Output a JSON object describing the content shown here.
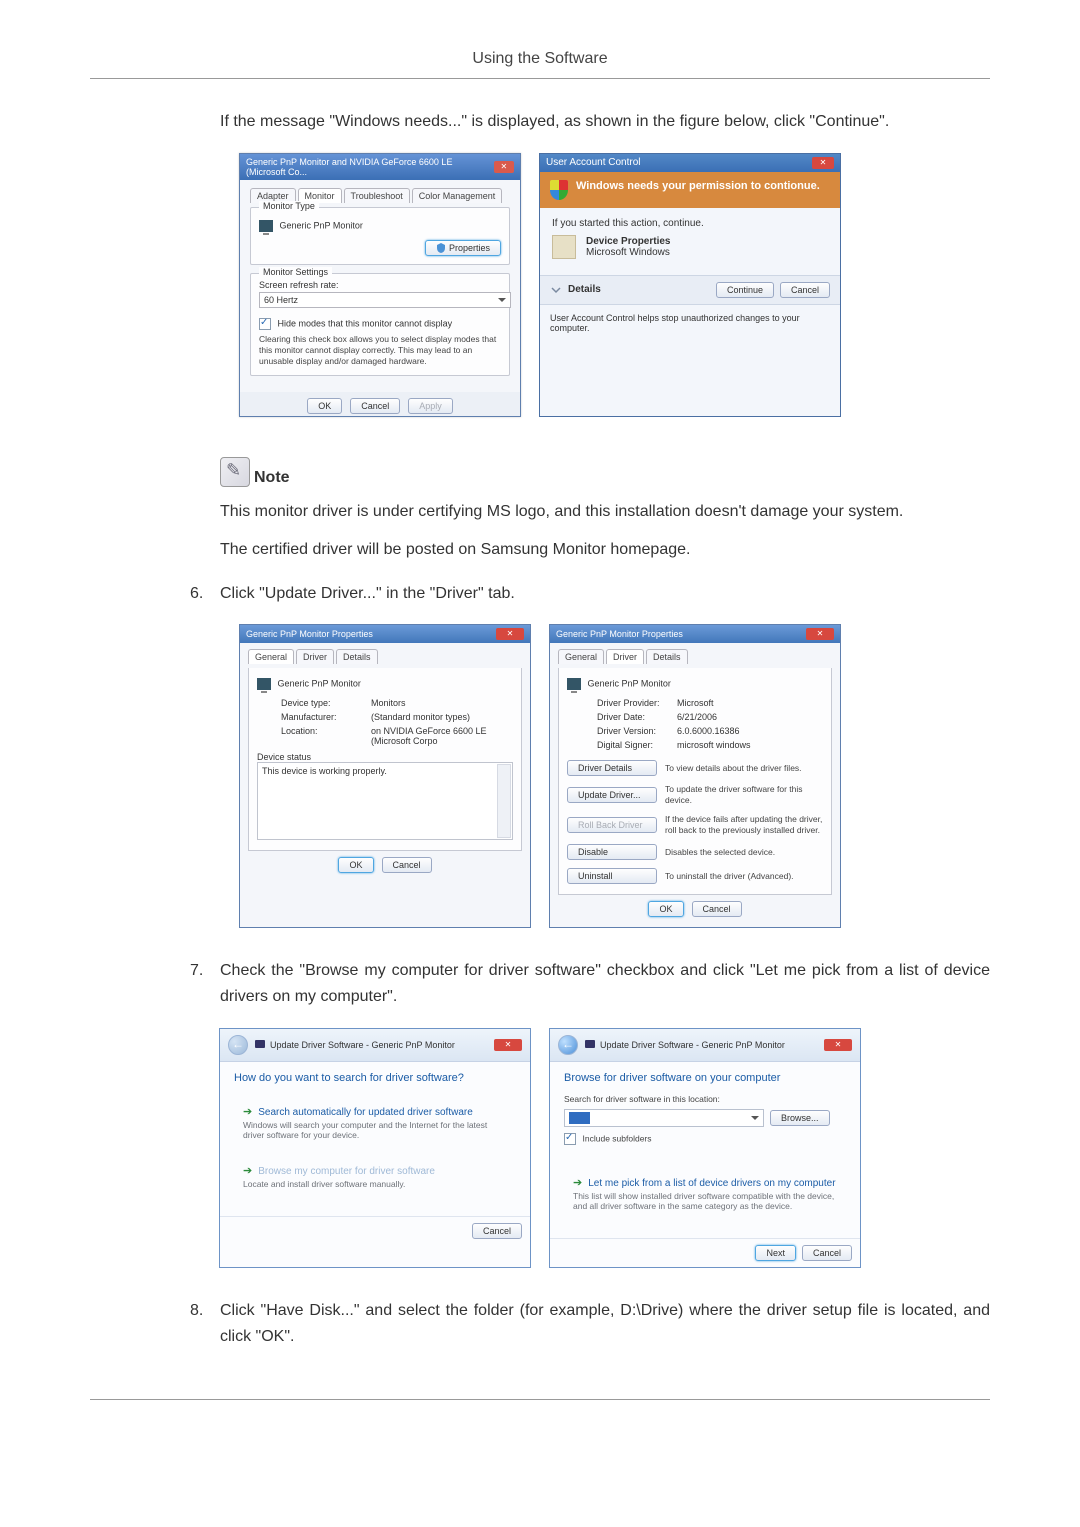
{
  "header": {
    "title": "Using the Software"
  },
  "para1": "If the message \"Windows needs...\" is displayed, as shown in the figure below, click \"Continue\".",
  "shot1": {
    "left": {
      "title": "Generic PnP Monitor and NVIDIA GeForce 6600 LE (Microsoft Co...",
      "tabs": {
        "a": "Adapter",
        "b": "Monitor",
        "c": "Troubleshoot",
        "d": "Color Management"
      },
      "group1_title": "Monitor Type",
      "mon_name": "Generic PnP Monitor",
      "prop_btn": "Properties",
      "group2_title": "Monitor Settings",
      "refresh_label": "Screen refresh rate:",
      "refresh_value": "60 Hertz",
      "hide_label": "Hide modes that this monitor cannot display",
      "hide_help": "Clearing this check box allows you to select display modes that this monitor cannot display correctly. This may lead to an unusable display and/or damaged hardware.",
      "ok": "OK",
      "cancel": "Cancel",
      "apply": "Apply"
    },
    "right": {
      "title": "User Account Control",
      "banner": "Windows needs your permission to contionue.",
      "started": "If you started this action, continue.",
      "device_props": "Device Properties",
      "ms_windows": "Microsoft Windows",
      "details": "Details",
      "continue": "Continue",
      "cancel": "Cancel",
      "help": "User Account Control helps stop unauthorized changes to your computer."
    }
  },
  "note_label": "Note",
  "note_para1": "This monitor driver is under certifying MS logo, and this installation doesn't damage your system.",
  "note_para2": "The certified driver will be posted on Samsung Monitor homepage.",
  "step6": {
    "num": "6.",
    "txt": "Click \"Update Driver...\" in the \"Driver\" tab."
  },
  "shot2": {
    "left": {
      "title": "Generic PnP Monitor Properties",
      "tabs": {
        "a": "General",
        "b": "Driver",
        "c": "Details"
      },
      "name": "Generic PnP Monitor",
      "rows": {
        "dt_l": "Device type:",
        "dt_v": "Monitors",
        "mf_l": "Manufacturer:",
        "mf_v": "(Standard monitor types)",
        "lo_l": "Location:",
        "lo_v": "on NVIDIA GeForce 6600 LE (Microsoft Corpo"
      },
      "status_title": "Device status",
      "status_text": "This device is working properly.",
      "ok": "OK",
      "cancel": "Cancel"
    },
    "right": {
      "title": "Generic PnP Monitor Properties",
      "tabs": {
        "a": "General",
        "b": "Driver",
        "c": "Details"
      },
      "name": "Generic PnP Monitor",
      "rows": {
        "dp_l": "Driver Provider:",
        "dp_v": "Microsoft",
        "dd_l": "Driver Date:",
        "dd_v": "6/21/2006",
        "dv_l": "Driver Version:",
        "dv_v": "6.0.6000.16386",
        "ds_l": "Digital Signer:",
        "ds_v": "microsoft windows"
      },
      "btns": {
        "details": "Driver Details",
        "details_d": "To view details about the driver files.",
        "update": "Update Driver...",
        "update_d": "To update the driver software for this device.",
        "roll": "Roll Back Driver",
        "roll_d": "If the device fails after updating the driver, roll back to the previously installed driver.",
        "disable": "Disable",
        "disable_d": "Disables the selected device.",
        "uninstall": "Uninstall",
        "uninstall_d": "To uninstall the driver (Advanced)."
      },
      "ok": "OK",
      "cancel": "Cancel"
    }
  },
  "step7": {
    "num": "7.",
    "txt": "Check the \"Browse my computer for driver software\" checkbox and click \"Let me pick from a list of device drivers on my computer\"."
  },
  "shot3": {
    "left": {
      "crumb": "Update Driver Software - Generic PnP Monitor",
      "question": "How do you want to search for driver software?",
      "opt1_h": "Search automatically for updated driver software",
      "opt1_s": "Windows will search your computer and the Internet for the latest driver software for your device.",
      "opt2_h": "Browse my computer for driver software",
      "opt2_s": "Locate and install driver software manually.",
      "cancel": "Cancel"
    },
    "right": {
      "crumb": "Update Driver Software - Generic PnP Monitor",
      "heading": "Browse for driver software on your computer",
      "search_label": "Search for driver software in this location:",
      "browse": "Browse...",
      "include": "Include subfolders",
      "opt_h": "Let me pick from a list of device drivers on my computer",
      "opt_s": "This list will show installed driver software compatible with the device, and all driver software in the same category as the device.",
      "next": "Next",
      "cancel": "Cancel"
    }
  },
  "step8": {
    "num": "8.",
    "txt": "Click \"Have Disk...\" and select the folder (for example, D:\\Drive) where the driver setup file is located, and click \"OK\"."
  }
}
